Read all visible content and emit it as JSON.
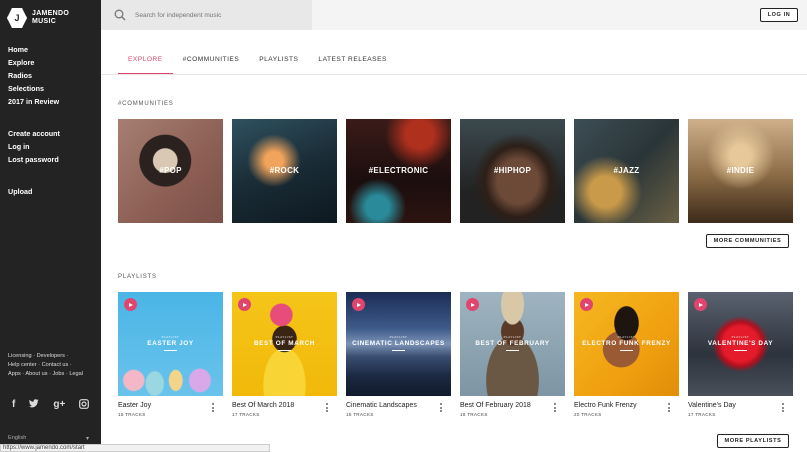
{
  "brand": {
    "mark": "J",
    "line1": "JAMENDO",
    "line2": "MUSIC"
  },
  "sidebar": {
    "main": [
      "Home",
      "Explore",
      "Radios",
      "Selections",
      "2017 in Review"
    ],
    "account": [
      "Create account",
      "Log in",
      "Lost password"
    ],
    "upload": "Upload",
    "footer": [
      "Licensing",
      "Developers",
      "Help center",
      "Contact us",
      "Apps",
      "About us",
      "Jobs",
      "Legal"
    ],
    "social": [
      "f",
      "t",
      "g+",
      "ig"
    ],
    "language": "English",
    "language_arrow": "▾"
  },
  "status_url": "https://www.jamendo.com/start",
  "search": {
    "placeholder": "Search for independent music"
  },
  "header": {
    "login": "LOG IN"
  },
  "tabs": [
    "EXPLORE",
    "#COMMUNITIES",
    "PLAYLISTS",
    "LATEST RELEASES"
  ],
  "communities": {
    "title": "#COMMUNITIES",
    "items": [
      "#POP",
      "#ROCK",
      "#ELECTRONIC",
      "#HIPHOP",
      "#JAZZ",
      "#INDIE"
    ],
    "more": "MORE COMMUNITIES"
  },
  "playlists": {
    "title": "PLAYLISTS",
    "items": [
      {
        "cover": "EASTER JOY",
        "name": "Easter Joy",
        "tracks": "15 TRACKS"
      },
      {
        "cover": "BEST OF MARCH",
        "name": "Best Of March 2018",
        "tracks": "17 TRACKS"
      },
      {
        "cover": "CINEMATIC LANDSCAPES",
        "name": "Cinematic Landscapes",
        "tracks": "15 TRACKS"
      },
      {
        "cover": "BEST OF FEBRUARY",
        "name": "Best Of February 2018",
        "tracks": "18 TRACKS"
      },
      {
        "cover": "ELECTRO FUNK FRENZY",
        "name": "Electro Funk Frenzy",
        "tracks": "20 TRACKS"
      },
      {
        "cover": "VALENTINE'S DAY",
        "name": "Valentine's Day",
        "tracks": "17 TRACKS"
      }
    ],
    "cover_sub": "PLAYLIST",
    "more": "MORE PLAYLISTS"
  },
  "colors": {
    "accent": "#e0456e",
    "sidebar": "#232323"
  }
}
